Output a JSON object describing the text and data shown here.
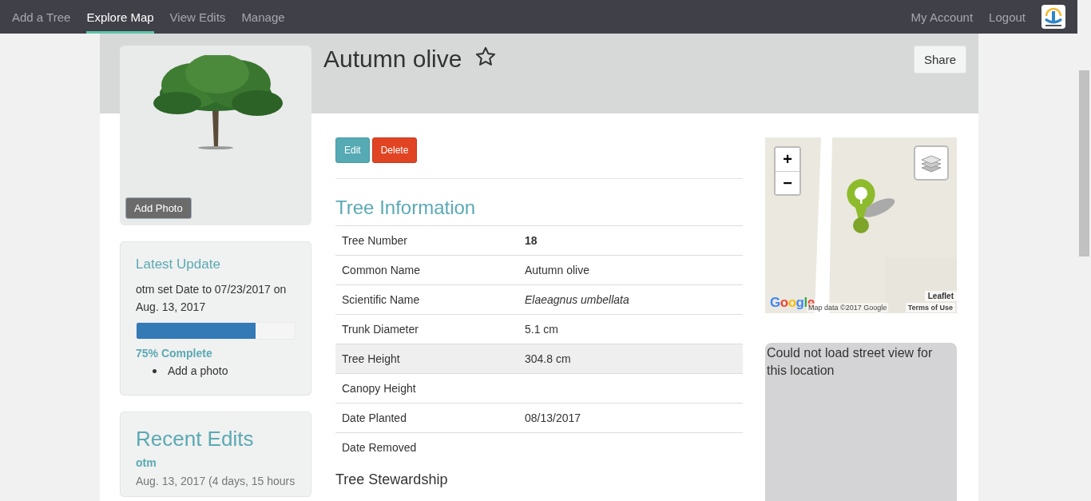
{
  "nav": {
    "left": [
      {
        "label": "Add a Tree",
        "selected": false
      },
      {
        "label": "Explore Map",
        "selected": true
      },
      {
        "label": "View Edits",
        "selected": false
      },
      {
        "label": "Manage",
        "selected": false
      }
    ],
    "right": [
      "My Account",
      "Logout"
    ]
  },
  "tree": {
    "title": "Autumn olive",
    "favorited": false,
    "share": "Share"
  },
  "photo": {
    "button": "Add Photo"
  },
  "actions": [
    {
      "label": "Edit",
      "kind": "primary"
    },
    {
      "label": "Delete",
      "kind": "danger"
    }
  ],
  "latest_update": {
    "title": "Latest Update",
    "text": "otm set Date to 07/23/2017 on Aug. 13, 2017",
    "level": 0.75,
    "progress_label": "75% Complete",
    "todo": [
      "Add a photo"
    ]
  },
  "recent_edits": {
    "title": "Recent Edits",
    "user": "otm",
    "date": "Aug. 13, 2017 (4 days, 15 hours"
  },
  "tree_information": {
    "title": "Tree Information",
    "rows": [
      {
        "label": "Tree Number",
        "value": "18",
        "kind": "bold",
        "hovered": false
      },
      {
        "label": "Common Name",
        "value": "Autumn olive",
        "kind": "plain",
        "hovered": false
      },
      {
        "label": "Scientific Name",
        "value": "Elaeagnus umbellata",
        "kind": "italic",
        "hovered": false
      },
      {
        "label": "Trunk Diameter",
        "value": "5.1 cm",
        "kind": "plain",
        "hovered": false
      },
      {
        "label": "Tree Height",
        "value": "304.8 cm",
        "kind": "plain",
        "hovered": true
      },
      {
        "label": "Canopy Height",
        "hovered": false
      },
      {
        "label": "Date Planted",
        "value": "08/13/2017",
        "kind": "plain",
        "hovered": false
      },
      {
        "label": "Date Removed",
        "hovered": false
      }
    ]
  },
  "tree_stewardship": {
    "title": "Tree Stewardship"
  },
  "map": {
    "zoom_in": "+",
    "zoom_out": "−",
    "logo": "Google",
    "attribution": "Leaflet",
    "map_data": "Map data ©2017 Google",
    "terms": "Terms of Use"
  },
  "street_view": {
    "message": "Could not load street view for this location"
  }
}
